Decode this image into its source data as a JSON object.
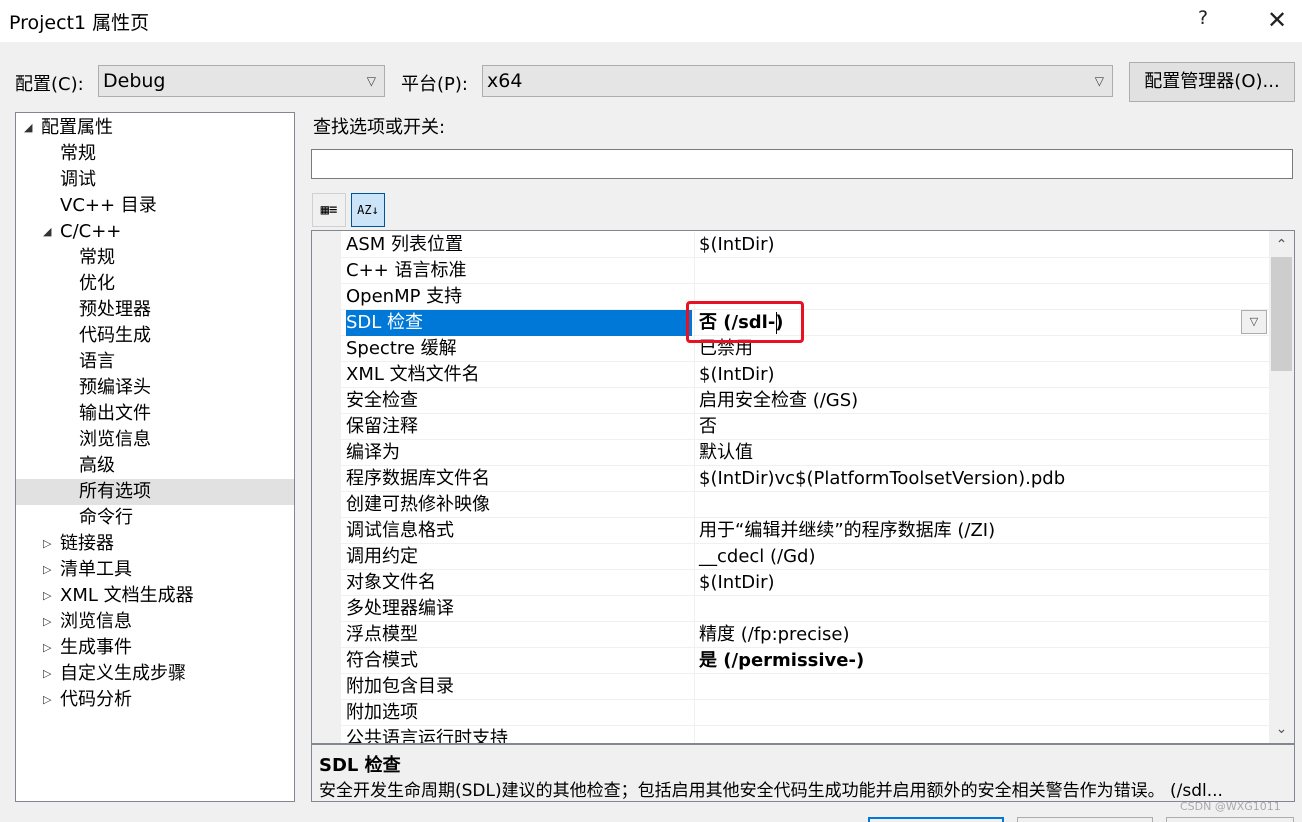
{
  "window": {
    "title": "Project1 属性页",
    "help": "?",
    "close": "✕"
  },
  "config": {
    "config_label": "配置(C):",
    "config_value": "Debug",
    "platform_label": "平台(P):",
    "platform_value": "x64",
    "manager_button": "配置管理器(O)..."
  },
  "tree": {
    "items": [
      {
        "label": "配置属性",
        "expander": "◢"
      },
      {
        "label": "常规"
      },
      {
        "label": "调试"
      },
      {
        "label": "VC++ 目录"
      },
      {
        "label": "C/C++",
        "expander": "◢"
      },
      {
        "label": "常规"
      },
      {
        "label": "优化"
      },
      {
        "label": "预处理器"
      },
      {
        "label": "代码生成"
      },
      {
        "label": "语言"
      },
      {
        "label": "预编译头"
      },
      {
        "label": "输出文件"
      },
      {
        "label": "浏览信息"
      },
      {
        "label": "高级"
      },
      {
        "label": "所有选项",
        "selected": true
      },
      {
        "label": "命令行"
      },
      {
        "label": "链接器",
        "expander": "▷"
      },
      {
        "label": "清单工具",
        "expander": "▷"
      },
      {
        "label": "XML 文档生成器",
        "expander": "▷"
      },
      {
        "label": "浏览信息",
        "expander": "▷"
      },
      {
        "label": "生成事件",
        "expander": "▷"
      },
      {
        "label": "自定义生成步骤",
        "expander": "▷"
      },
      {
        "label": "代码分析",
        "expander": "▷"
      }
    ]
  },
  "search": {
    "label": "查找选项或开关:",
    "value": ""
  },
  "toolbar": {
    "categorized": "▦≡",
    "alphabetical": "AZ↓"
  },
  "grid": {
    "rows": [
      {
        "key": "ASM 列表位置",
        "value": "$(IntDir)"
      },
      {
        "key": "C++ 语言标准",
        "value": ""
      },
      {
        "key": "OpenMP 支持",
        "value": ""
      },
      {
        "key": "SDL 检查",
        "value": "否 (/sdl-)",
        "selected": true,
        "bold": true
      },
      {
        "key": "Spectre 缓解",
        "value": "已禁用"
      },
      {
        "key": "XML 文档文件名",
        "value": "$(IntDir)"
      },
      {
        "key": "安全检查",
        "value": "启用安全检查 (/GS)"
      },
      {
        "key": "保留注释",
        "value": "否"
      },
      {
        "key": "编译为",
        "value": "默认值"
      },
      {
        "key": "程序数据库文件名",
        "value": "$(IntDir)vc$(PlatformToolsetVersion).pdb"
      },
      {
        "key": "创建可热修补映像",
        "value": ""
      },
      {
        "key": "调试信息格式",
        "value": "用于“编辑并继续”的程序数据库 (/ZI)"
      },
      {
        "key": "调用约定",
        "value": "__cdecl (/Gd)"
      },
      {
        "key": "对象文件名",
        "value": "$(IntDir)"
      },
      {
        "key": "多处理器编译",
        "value": ""
      },
      {
        "key": "浮点模型",
        "value": "精度 (/fp:precise)"
      },
      {
        "key": "符合模式",
        "value": "是 (/permissive-)",
        "bold": true
      },
      {
        "key": "附加包含目录",
        "value": ""
      },
      {
        "key": "附加选项",
        "value": ""
      },
      {
        "key": "公共语言运行时支持",
        "value": ""
      }
    ],
    "dropdown_arrow": "▽",
    "scroll_up": "⌃",
    "scroll_down": "⌄"
  },
  "description": {
    "title": "SDL 检查",
    "body": "安全开发生命周期(SDL)建议的其他检查；包括启用其他安全代码生成功能并启用额外的安全相关警告作为错误。    (/sdl..."
  },
  "watermark": "CSDN @WXG1011",
  "colors": {
    "selection": "#0078d7",
    "highlight_box": "#e81123"
  }
}
